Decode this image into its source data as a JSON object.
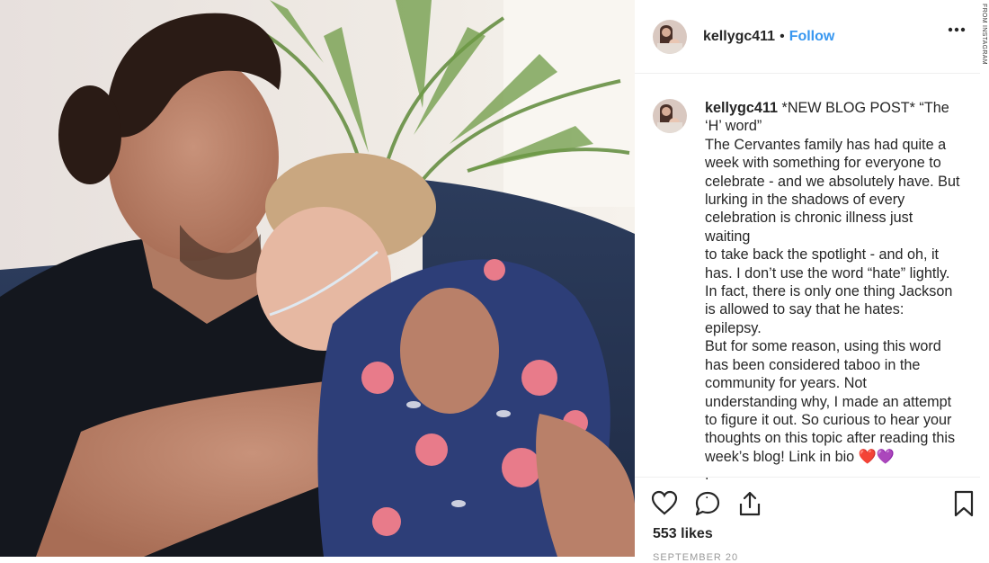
{
  "post": {
    "username": "kellygc411",
    "separator": "•",
    "follow_label": "Follow",
    "caption_lines": [
      "*NEW BLOG POST* “The",
      "‘H’ word”",
      "The Cervantes family has had quite a",
      "week with something for everyone to",
      "celebrate - and we absolutely have. But",
      "lurking in the shadows of every",
      "celebration is chronic illness just waiting",
      "to take back the spotlight - and oh, it",
      "has. I don’t use the word “hate” lightly.",
      "In fact, there is only one thing Jackson",
      "is allowed to say that he hates: epilepsy.",
      "But for some reason, using this word",
      "has been considered taboo in the",
      "community for years. Not",
      "understanding why, I made an attempt",
      "to figure it out. So curious to hear your",
      "thoughts on this topic after reading this",
      "week’s blog! Link in bio ❤️💜",
      ".",
      "."
    ],
    "likes": "553 likes",
    "date": "SEPTEMBER 20"
  },
  "credit": "FROM INSTAGRAM",
  "icons": {
    "more": "more-options-icon",
    "like": "heart-icon",
    "comment": "comment-icon",
    "share": "share-icon",
    "save": "bookmark-icon"
  },
  "colors": {
    "link": "#3897f0",
    "text": "#262626",
    "border": "#efefef"
  }
}
